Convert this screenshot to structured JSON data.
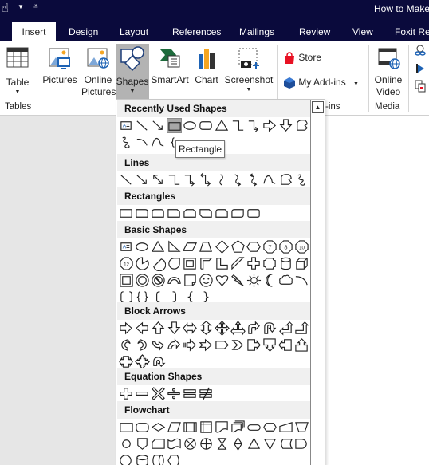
{
  "window": {
    "title": "How to Make",
    "quick_access": {
      "touch_mode_icon": "touch-mode-icon",
      "dropdown_icon": "caret-down-icon",
      "customize_icon": "customize-qat-icon"
    }
  },
  "tabs": [
    {
      "label": "Insert",
      "active": true
    },
    {
      "label": "Design"
    },
    {
      "label": "Layout"
    },
    {
      "label": "References"
    },
    {
      "label": "Mailings"
    },
    {
      "label": "Review"
    },
    {
      "label": "View"
    },
    {
      "label": "Foxit Re"
    }
  ],
  "ribbon": {
    "table": {
      "label": "Table",
      "group": "Tables"
    },
    "pictures": {
      "label": "Pictures"
    },
    "online_pictures": {
      "label1": "Online",
      "label2": "Pictures"
    },
    "shapes": {
      "label": "Shapes"
    },
    "smartart": {
      "label": "SmartArt"
    },
    "chart": {
      "label": "Chart"
    },
    "screenshot": {
      "label": "Screenshot"
    },
    "store": {
      "label": "Store"
    },
    "my_addins": {
      "label": "My Add-ins"
    },
    "addins_group": "-ins",
    "online_video": {
      "label1": "Online",
      "label2": "Video",
      "group": "Media"
    },
    "colors": {
      "accent_orange": "#f5a623",
      "accent_blue": "#1e63b5",
      "store_red": "#e81123",
      "excel_green": "#1e6b3c"
    }
  },
  "shapes_menu": {
    "tooltip": "Rectangle",
    "selected": "Rectangle",
    "sections": [
      {
        "title": "Recently Used Shapes",
        "count": 18
      },
      {
        "title": "Lines",
        "count": 12
      },
      {
        "title": "Rectangles",
        "count": 9
      },
      {
        "title": "Basic Shapes",
        "count": 42
      },
      {
        "title": "Block Arrows",
        "count": 27
      },
      {
        "title": "Equation Shapes",
        "count": 6
      },
      {
        "title": "Flowchart",
        "count": 28
      }
    ],
    "octagon_labels": [
      "7",
      "8",
      "10",
      "12"
    ]
  }
}
